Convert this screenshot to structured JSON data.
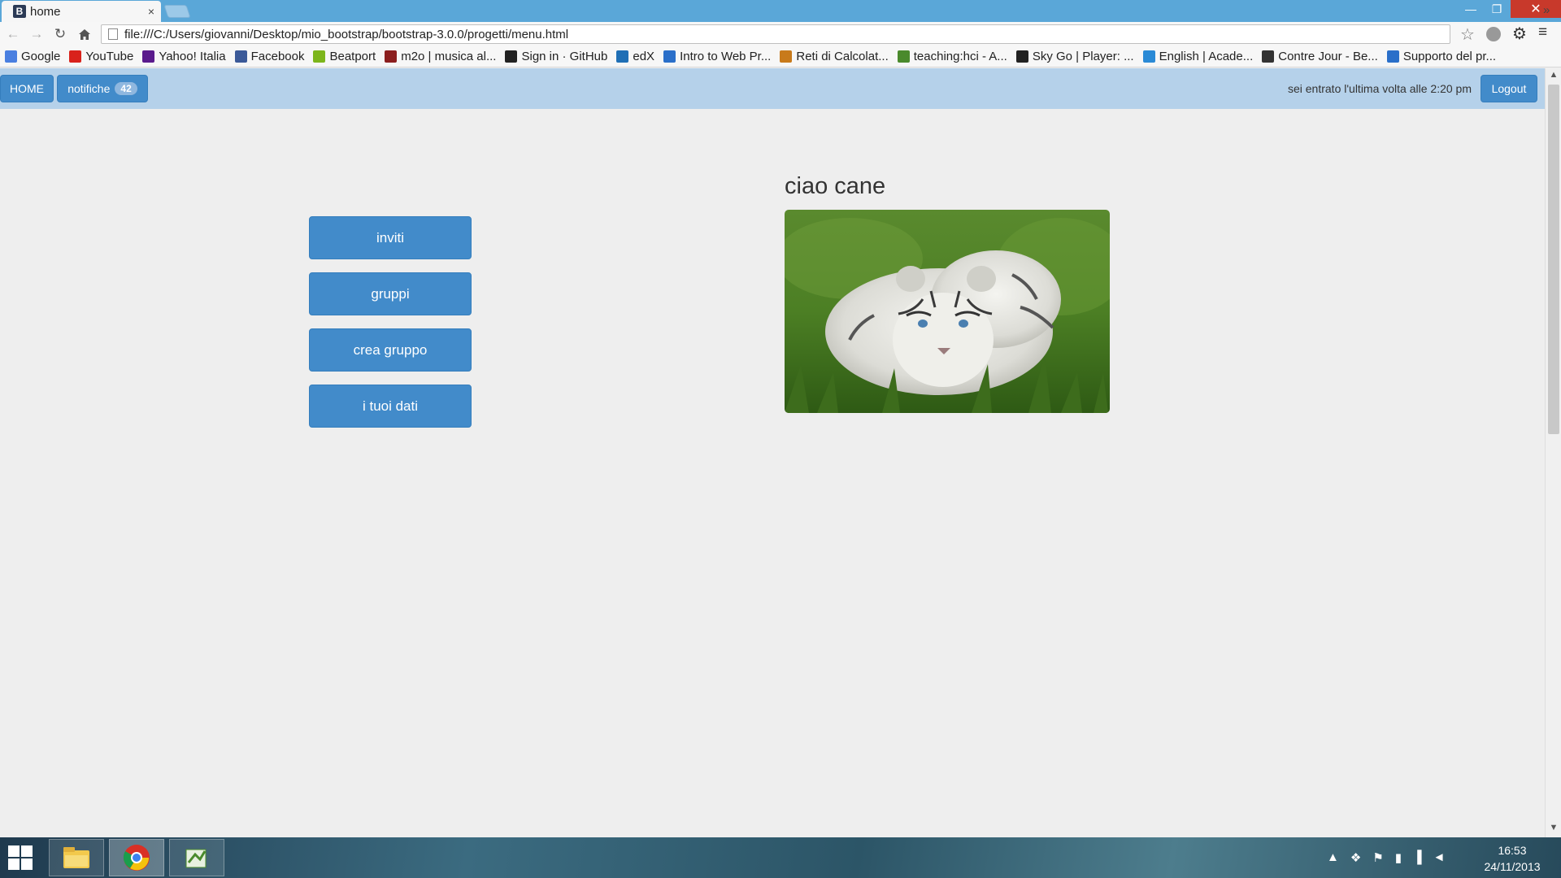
{
  "browser": {
    "tab_title": "home",
    "tab_favicon": "B",
    "tab_close": "×",
    "url": "file:///C:/Users/giovanni/Desktop/mio_bootstrap/bootstrap-3.0.0/progetti/menu.html",
    "bookmarks": [
      {
        "label": "Google",
        "icon": "google-icon",
        "color": "#4a7fe0"
      },
      {
        "label": "YouTube",
        "icon": "youtube-icon",
        "color": "#d9221b"
      },
      {
        "label": "Yahoo! Italia",
        "icon": "yahoo-icon",
        "color": "#5a1a8c"
      },
      {
        "label": "Facebook",
        "icon": "facebook-icon",
        "color": "#3b5998"
      },
      {
        "label": "Beatport",
        "icon": "beatport-icon",
        "color": "#7cb51b"
      },
      {
        "label": "m2o | musica al...",
        "icon": "m2o-icon",
        "color": "#8b1e1e"
      },
      {
        "label": "Sign in · GitHub",
        "icon": "github-icon",
        "color": "#222222"
      },
      {
        "label": "edX",
        "icon": "edx-icon",
        "color": "#1f6fb5"
      },
      {
        "label": "Intro to Web Pr...",
        "icon": "page-icon",
        "color": "#2a6fc9"
      },
      {
        "label": "Reti di Calcolat...",
        "icon": "unipd-icon",
        "color": "#c87a1b"
      },
      {
        "label": "teaching:hci - A...",
        "icon": "wiki-icon",
        "color": "#4a8a2c"
      },
      {
        "label": "Sky Go | Player: ...",
        "icon": "sky-icon",
        "color": "#222222"
      },
      {
        "label": "English | Acade...",
        "icon": "english-icon",
        "color": "#2a8ad6"
      },
      {
        "label": "Contre Jour - Be...",
        "icon": "contrejour-icon",
        "color": "#333333"
      },
      {
        "label": "Supporto del pr...",
        "icon": "support-icon",
        "color": "#2a6fc9"
      }
    ],
    "bookmarks_more": "»"
  },
  "page": {
    "home_label": "HOME",
    "notifications_label": "notifiche",
    "notifications_count": "42",
    "last_login": "sei entrato l'ultima volta alle 2:20 pm",
    "logout_label": "Logout",
    "menu": [
      "inviti",
      "gruppi",
      "crea gruppo",
      "i tuoi dati"
    ],
    "heading": "ciao cane",
    "photo_subject": "white-tiger-cub-photo"
  },
  "taskbar": {
    "time": "16:53",
    "date": "24/11/2013",
    "tray_arrow": "▲"
  },
  "colors": {
    "primary_button": "#428bca",
    "navbar_bg": "#b5d1ea",
    "page_bg": "#eeeeee"
  }
}
